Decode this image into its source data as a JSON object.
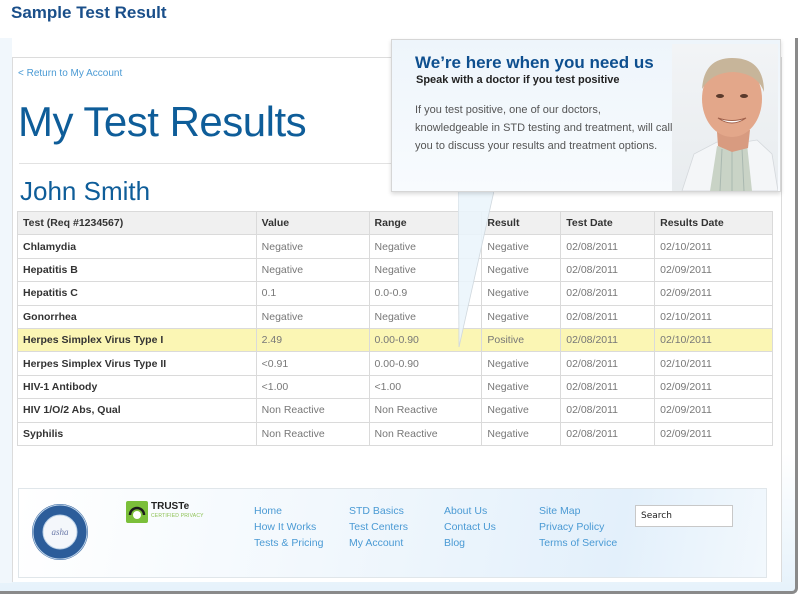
{
  "header": {
    "title": "Sample Test Result"
  },
  "nav": {
    "return_link": "< Return to My Account"
  },
  "main": {
    "heading": "My Test Results",
    "patient_name": "John Smith"
  },
  "callout": {
    "title": "We’re here when you need us",
    "subtitle": "Speak with a doctor if you test positive",
    "body": "If you test positive, one of our doctors, knowledgeable in STD testing and treatment, will call you to discuss your results and treatment options.",
    "image": "doctor-portrait"
  },
  "table": {
    "columns": [
      "Test (Req #1234567)",
      "Value",
      "Range",
      "Result",
      "Test Date",
      "Results Date"
    ],
    "rows": [
      {
        "test": "Chlamydia",
        "value": "Negative",
        "range": "Negative",
        "result": "Negative",
        "test_date": "02/08/2011",
        "results_date": "02/10/2011"
      },
      {
        "test": "Hepatitis B",
        "value": "Negative",
        "range": "Negative",
        "result": "Negative",
        "test_date": "02/08/2011",
        "results_date": "02/09/2011"
      },
      {
        "test": "Hepatitis C",
        "value": "0.1",
        "range": "0.0-0.9",
        "result": "Negative",
        "test_date": "02/08/2011",
        "results_date": "02/09/2011"
      },
      {
        "test": "Gonorrhea",
        "value": "Negative",
        "range": "Negative",
        "result": "Negative",
        "test_date": "02/08/2011",
        "results_date": "02/10/2011"
      },
      {
        "test": "Herpes Simplex Virus Type I",
        "value": "2.49",
        "range": "0.00-0.90",
        "result": "Positive",
        "test_date": "02/08/2011",
        "results_date": "02/10/2011",
        "highlighted": true
      },
      {
        "test": "Herpes Simplex Virus Type II",
        "value": "<0.91",
        "range": "0.00-0.90",
        "result": "Negative",
        "test_date": "02/08/2011",
        "results_date": "02/10/2011"
      },
      {
        "test": "HIV-1 Antibody",
        "value": "<1.00",
        "range": "<1.00",
        "result": "Negative",
        "test_date": "02/08/2011",
        "results_date": "02/09/2011"
      },
      {
        "test": "HIV 1/O/2 Abs, Qual",
        "value": "Non Reactive",
        "range": "Non Reactive",
        "result": "Negative",
        "test_date": "02/08/2011",
        "results_date": "02/09/2011"
      },
      {
        "test": "Syphilis",
        "value": "Non Reactive",
        "range": "Non Reactive",
        "result": "Negative",
        "test_date": "02/08/2011",
        "results_date": "02/09/2011"
      }
    ],
    "highlight_color": "#fbf6b4"
  },
  "footer": {
    "asha_seal": {
      "top_text": "REVIEWED FOR PHSH BY ASHA",
      "center": "asha",
      "bottom_text": "CLICK TO VERIFY"
    },
    "truste": {
      "name": "TRUSTe",
      "sub": "CERTIFIED PRIVACY"
    },
    "link_columns": [
      [
        "Home",
        "How It Works",
        "Tests & Pricing"
      ],
      [
        "STD Basics",
        "Test Centers",
        "My Account"
      ],
      [
        "About Us",
        "Contact Us",
        "Blog"
      ],
      [
        "Site Map",
        "Privacy Policy",
        "Terms of Service"
      ]
    ],
    "search": {
      "value": "Search"
    }
  },
  "colors": {
    "brand_blue": "#0e5d99",
    "link_blue": "#4a9ad4",
    "title_blue": "#1a4f8a"
  }
}
